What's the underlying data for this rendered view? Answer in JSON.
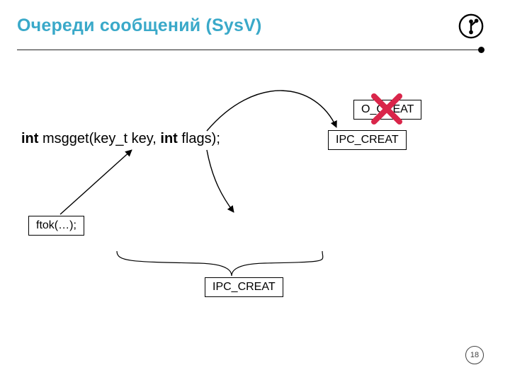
{
  "title": "Очереди сообщений (SysV)",
  "signature": {
    "ret": "int",
    "name": "msgget",
    "p1type": "key_t",
    "p1name": "key",
    "p2type": "int",
    "p2name": "flags"
  },
  "boxes": {
    "ftok": "ftok(…);",
    "ipc_creat_top": "IPC_CREAT",
    "o_creat": "O_CREAT",
    "ipc_creat_bottom": "IPC_CREAT"
  },
  "page": "18"
}
